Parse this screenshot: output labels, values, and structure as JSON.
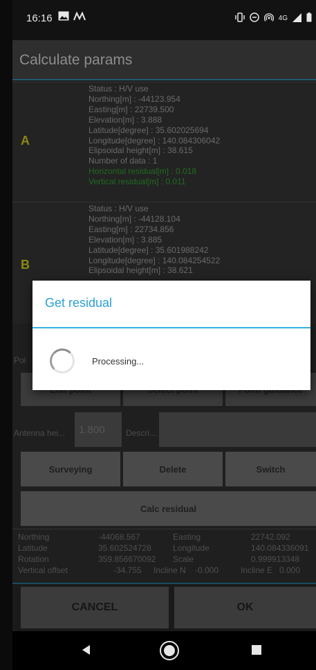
{
  "status_bar": {
    "time": "16:16",
    "network": "4G"
  },
  "app": {
    "title": "Calculate params",
    "point_a": {
      "letter": "A",
      "lines": [
        "Status : H/V use",
        "Northing[m] : -44123.954",
        "Easting[m] : 22739.500",
        "Elevation[m] : 3.888",
        "Latitude[degree] : 35.602025694",
        "Longitude[degree] : 140.084306042",
        "Elipsoidal height[m] : 38.615",
        "Number of data : 1"
      ],
      "green_lines": [
        "Horizontal residual[m] : 0.018",
        "Vertical residual[m] : 0.011"
      ]
    },
    "point_b": {
      "letter": "B",
      "lines": [
        "Status : H/V use",
        "Northing[m] : -44128.104",
        "Easting[m] : 22734.856",
        "Elevation[m] : 3.885",
        "Latitude[degree] : 35.601988242",
        "Longitude[degree] : 140.084254522",
        "Elipsoidal height[m] : 38.621"
      ]
    },
    "point_label_stub": "Poi",
    "point_buttons": [
      "Edit point",
      "Select point",
      "Point guidance"
    ],
    "antenna": {
      "label": "Antenna hei...",
      "value": "1.800"
    },
    "description": {
      "label": "Descri...",
      "value": ""
    },
    "action_buttons": [
      "Surveying",
      "Delete",
      "Switch"
    ],
    "calc_button": "Calc residual",
    "results": {
      "northing_label": "Northing",
      "northing": "-44068.567",
      "easting_label": "Easting",
      "easting": "22742.092",
      "latitude_label": "Latitude",
      "latitude": "35.602524728",
      "longitude_label": "Longitude",
      "longitude": "140.084336091",
      "rotation_label": "Rotation",
      "rotation": "359.856670092",
      "scale_label": "Scale",
      "scale": "0.999913348",
      "vertical_offset_label": "Vertical offset",
      "vertical_offset": "-34.755",
      "incline_n_label": "Incline N",
      "incline_n": "-0.000",
      "incline_e_label": "Incline E",
      "incline_e": "0.000"
    },
    "cancel_label": "CANCEL",
    "ok_label": "OK"
  },
  "dialog": {
    "title": "Get residual",
    "message": "Processing..."
  },
  "colors": {
    "accent": "#35b0e6",
    "dialog_title": "#2aa0d4",
    "point_letter": "#8a8a12",
    "residual_text": "#1f6a1f"
  },
  "icons": [
    "image-icon",
    "signal-activity-icon",
    "vibrate-icon",
    "do-not-disturb-icon",
    "hotspot-icon",
    "cell-signal-icon",
    "battery-icon",
    "back-icon",
    "home-icon",
    "recents-icon"
  ]
}
